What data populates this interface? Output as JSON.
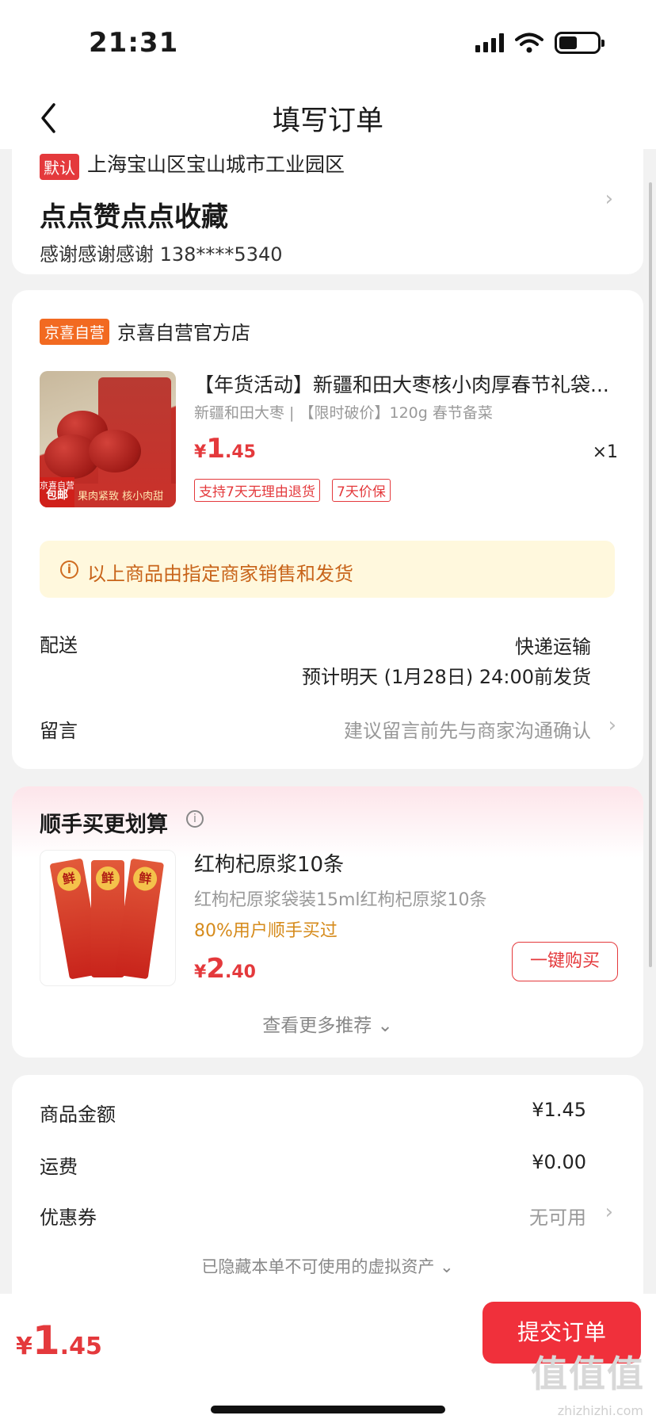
{
  "status_bar": {
    "time": "21:31"
  },
  "nav": {
    "title": "填写订单"
  },
  "address": {
    "default_tag": "默认",
    "region": "上海宝山区宝山城市工业园区",
    "detail": "点点赞点点收藏",
    "contact": "感谢感谢感谢  138****5340"
  },
  "shop": {
    "tag": "京喜自营",
    "name": "京喜自营官方店",
    "product": {
      "title": "【年货活动】新疆和田大枣核小肉厚春节礼袋...",
      "spec": "新疆和田大枣 | 【限时破价】120g 春节备菜",
      "price_symbol": "¥",
      "price_int": "1",
      "price_dec": ".45",
      "quantity": "×1",
      "services": [
        "支持7天无理由退货",
        "7天价保"
      ],
      "thumb_badge_top": "京喜自营",
      "thumb_badge_bottom": "包邮",
      "thumb_slogan": "果肉紧致 核小肉甜"
    },
    "notice": "以上商品由指定商家销售和发货",
    "delivery": {
      "label": "配送",
      "method": "快递运输",
      "eta": "预计明天 (1月28日) 24:00前发货"
    },
    "message": {
      "label": "留言",
      "hint": "建议留言前先与商家沟通确认"
    }
  },
  "upsell": {
    "title": "顺手买更划算",
    "item": {
      "name": "红枸杞原浆10条",
      "desc": "红枸杞原浆袋装15ml红枸杞原浆10条",
      "bought": "80%用户顺手买过",
      "price_symbol": "¥",
      "price_int": "2",
      "price_dec": ".40",
      "buy_label": "一键购买",
      "stick_label": "鲜"
    },
    "more_label": "查看更多推荐"
  },
  "summary": {
    "rows": [
      {
        "label": "商品金额",
        "value": "¥1.45"
      },
      {
        "label": "运费",
        "value": "¥0.00"
      },
      {
        "label": "优惠券",
        "value": "无可用"
      }
    ],
    "hidden_note": "已隐藏本单不可使用的虚拟资产"
  },
  "bottom": {
    "price_symbol": "¥",
    "price_int": "1",
    "price_dec": ".45",
    "submit_label": "提交订单",
    "watermark": "值值值",
    "watermark_sub": "zhizhizhi.com"
  },
  "colors": {
    "accent": "#e4393c",
    "warning_bg": "#fff8dd",
    "warning_text": "#c8641a",
    "bought_text": "#d68b1c"
  }
}
